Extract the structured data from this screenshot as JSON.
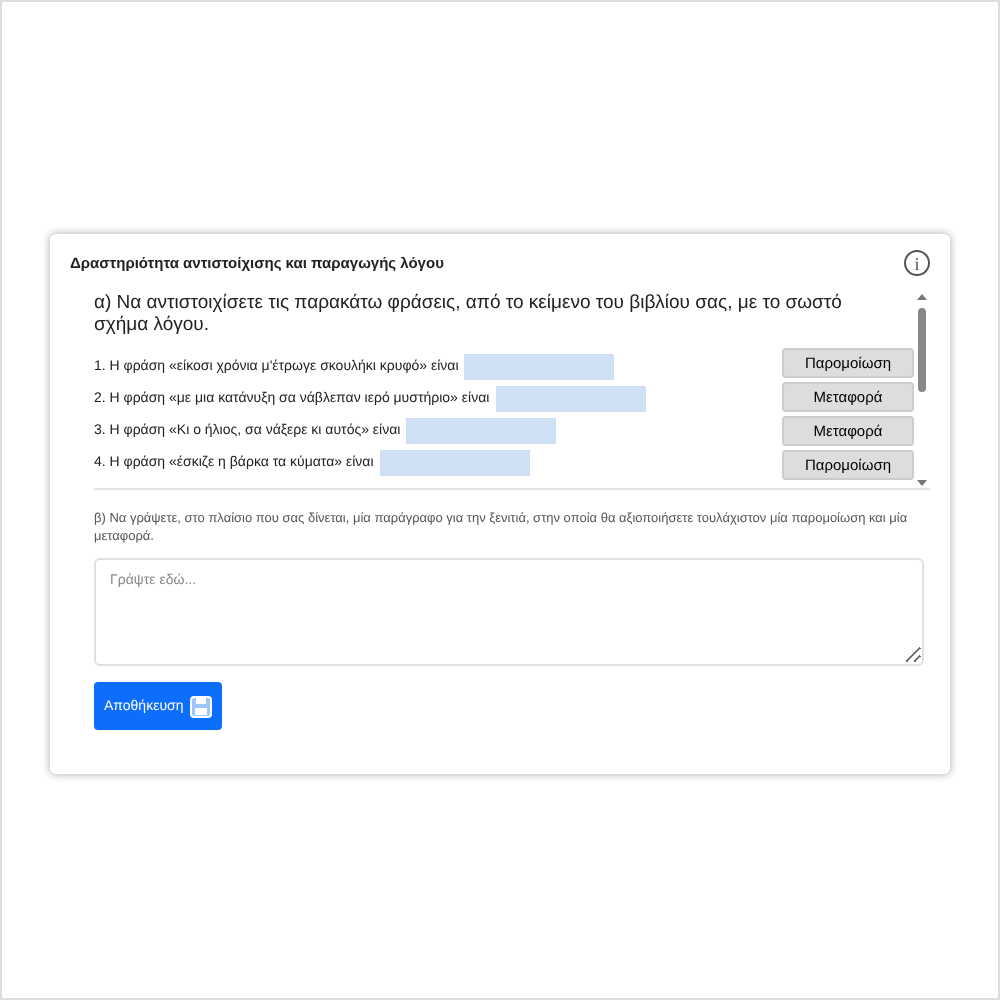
{
  "card": {
    "title": "Δραστηριότητα αντιστοίχισης και παραγωγής λόγου",
    "info_icon": "i"
  },
  "part_a": {
    "question": "α) Να αντιστοιχίσετε τις παρακάτω φράσεις, από το κείμενο του βιβλίου σας, με το σωστό σχήμα λόγου.",
    "items": [
      {
        "text": "1. Η φράση «είκοσι χρόνια μ'έτρωγε σκουλήκι κρυφό» είναι"
      },
      {
        "text": "2. Η φράση «με μια κατάνυξη σα νάβλεπαν ιερό μυστήριο» είναι"
      },
      {
        "text": "3. Η φράση «Κι ο ήλιος, σα νάξερε κι αυτός» είναι"
      },
      {
        "text": "4. Η φράση «έσκιζε η βάρκα τα κύματα» είναι"
      }
    ],
    "options": [
      "Παρομοίωση",
      "Μεταφορά",
      "Μεταφορά",
      "Παρομοίωση"
    ]
  },
  "part_b": {
    "question": "β) Να γράψετε, στο πλαίσιο που σας δίνεται, μία παράγραφο για την ξενιτιά, στην οποία θα αξιοποιήσετε τουλάχιστον μία παρομοίωση και μία μεταφορά.",
    "placeholder": "Γράψτε εδώ..."
  },
  "save_button": "Αποθήκευση"
}
